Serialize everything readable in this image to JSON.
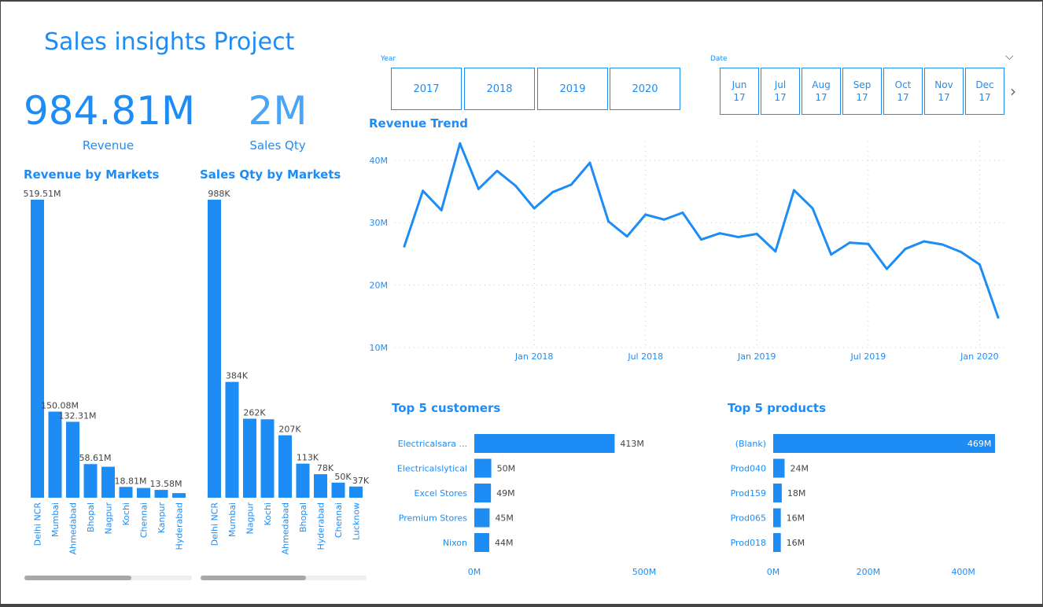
{
  "title": "Sales insights Project",
  "kpis": {
    "revenue_value": "984.81M",
    "revenue_label": "Revenue",
    "qty_value": "2M",
    "qty_label": "Sales Qty"
  },
  "slicers": {
    "year_label": "Year",
    "years": [
      "2017",
      "2018",
      "2019",
      "2020"
    ],
    "date_label": "Date",
    "months": [
      {
        "month": "Jun",
        "year": "17"
      },
      {
        "month": "Jul",
        "year": "17"
      },
      {
        "month": "Aug",
        "year": "17"
      },
      {
        "month": "Sep",
        "year": "17"
      },
      {
        "month": "Oct",
        "year": "17"
      },
      {
        "month": "Nov",
        "year": "17"
      },
      {
        "month": "Dec",
        "year": "17"
      }
    ]
  },
  "colors": {
    "accent": "#1e8cf5",
    "text_dark": "#444444",
    "grid": "#c8c8c8"
  },
  "chart_data": [
    {
      "type": "bar",
      "title": "Revenue by Markets",
      "categories": [
        "Delhi NCR",
        "Mumbai",
        "Ahmedabad",
        "Bhopal",
        "Nagpur",
        "Kochi",
        "Chennai",
        "Kanpur",
        "Hyderabad"
      ],
      "values": [
        519.51,
        150.08,
        132.31,
        58.61,
        54.0,
        18.81,
        17.0,
        13.58,
        8.0
      ],
      "labels": [
        "519.51M",
        "150.08M",
        "132.31M",
        "58.61M",
        "",
        "18.81M",
        "",
        "13.58M",
        ""
      ],
      "units": "M"
    },
    {
      "type": "bar",
      "title": "Sales Qty by Markets",
      "categories": [
        "Delhi NCR",
        "Mumbai",
        "Nagpur",
        "Kochi",
        "Ahmedabad",
        "Bhopal",
        "Hyderabad",
        "Chennai",
        "Lucknow"
      ],
      "values": [
        988,
        384,
        262,
        260,
        207,
        113,
        78,
        50,
        37
      ],
      "labels": [
        "988K",
        "384K",
        "262K",
        "",
        "207K",
        "113K",
        "78K",
        "50K",
        "37K"
      ],
      "units": "K"
    },
    {
      "type": "line",
      "title": "Revenue Trend",
      "ytick_labels": [
        "10M",
        "20M",
        "30M",
        "40M"
      ],
      "yticks": [
        10,
        20,
        30,
        40
      ],
      "ylim": [
        10,
        43
      ],
      "xtick_labels": [
        "Jan 2018",
        "Jul 2018",
        "Jan 2019",
        "Jul 2019",
        "Jan 2020"
      ],
      "xtick_positions": [
        7,
        13,
        19,
        25,
        31
      ],
      "x": [
        0,
        1,
        2,
        3,
        4,
        5,
        6,
        7,
        8,
        9,
        10,
        11,
        12,
        13,
        14,
        15,
        16,
        17,
        18,
        19,
        20,
        21,
        22,
        23,
        24,
        25,
        26,
        27,
        28,
        29,
        30,
        31,
        32,
        33,
        34,
        35,
        36,
        37
      ],
      "values": [
        26.2,
        35.1,
        32.0,
        42.7,
        35.4,
        38.3,
        35.9,
        32.3,
        34.9,
        36.1,
        39.6,
        30.2,
        27.8,
        31.3,
        30.5,
        31.6,
        27.3,
        28.3,
        27.7,
        28.2,
        25.4,
        35.2,
        32.3,
        24.9,
        26.8,
        26.6,
        22.6,
        25.8,
        27.0,
        26.5,
        25.3,
        23.3,
        14.8
      ],
      "grid": true
    },
    {
      "type": "bar",
      "orientation": "horizontal",
      "title": "Top 5 customers",
      "categories": [
        "Electricalsara ...",
        "Electricalslytical",
        "Excel Stores",
        "Premium Stores",
        "Nixon"
      ],
      "values": [
        413,
        50,
        49,
        45,
        44
      ],
      "labels": [
        "413M",
        "50M",
        "49M",
        "45M",
        "44M"
      ],
      "xtick_labels": [
        "0M",
        "500M"
      ],
      "xlim": [
        0,
        500
      ]
    },
    {
      "type": "bar",
      "orientation": "horizontal",
      "title": "Top 5 products",
      "categories": [
        "(Blank)",
        "Prod040",
        "Prod159",
        "Prod065",
        "Prod018"
      ],
      "values": [
        469,
        24,
        18,
        16,
        16
      ],
      "labels": [
        "469M",
        "24M",
        "18M",
        "16M",
        "16M"
      ],
      "xtick_labels": [
        "0M",
        "200M",
        "400M"
      ],
      "xlim": [
        0,
        470
      ]
    }
  ]
}
